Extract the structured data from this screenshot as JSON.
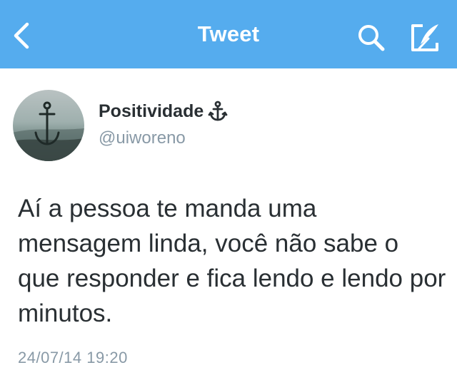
{
  "header": {
    "title": "Tweet",
    "back_icon": "chevron-left-icon",
    "search_icon": "search-icon",
    "compose_icon": "compose-icon",
    "background_color": "#55acee"
  },
  "tweet": {
    "author": {
      "display_name": "Positividade",
      "name_emoji_icon": "anchor-icon",
      "handle": "@uiworeno"
    },
    "text": "Aí a pessoa te manda uma mensagem linda, você não sabe o que responder e fica lendo e lendo por minutos.",
    "timestamp": "24/07/14 19:20"
  }
}
